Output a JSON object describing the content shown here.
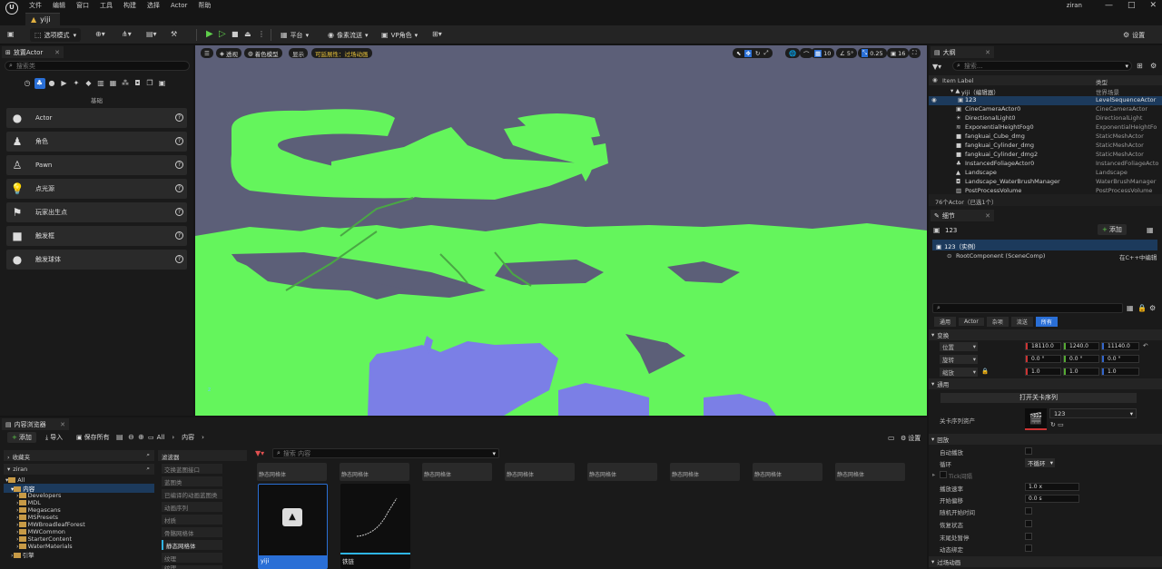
{
  "menubar": {
    "logo": "U",
    "menus": [
      "文件",
      "编辑",
      "窗口",
      "工具",
      "构建",
      "选择",
      "Actor",
      "帮助"
    ],
    "doc_tab": "yiji",
    "user": "ziran",
    "window_buttons": [
      "—",
      "□",
      "✕"
    ]
  },
  "toolbar": {
    "select_mode": "选项模式",
    "platform": "平台",
    "pixel_streaming": "像素流送",
    "vp_role": "VP角色",
    "settings": "设置"
  },
  "place_actor": {
    "tab": "放置Actor",
    "search_placeholder": "搜索类",
    "category": "基础",
    "items": [
      {
        "label": "Actor",
        "icon": "sphere-icon"
      },
      {
        "label": "角色",
        "icon": "character-icon"
      },
      {
        "label": "Pawn",
        "icon": "pawn-icon"
      },
      {
        "label": "点光源",
        "icon": "bulb-icon"
      },
      {
        "label": "玩家出生点",
        "icon": "flag-icon"
      },
      {
        "label": "触发框",
        "icon": "cube-icon"
      },
      {
        "label": "触发球体",
        "icon": "sphere-icon"
      }
    ]
  },
  "viewport": {
    "perspective": "透视",
    "view_mode": "着色模型",
    "show": "显示",
    "visibility": "可延展性：过场动画",
    "grid": "10",
    "angle": "5°",
    "scale": "0.25",
    "speed": "16",
    "axis": "z"
  },
  "outliner": {
    "tab": "大纲",
    "search_placeholder": "搜索...",
    "col_label": "Item Label",
    "col_type": "类型",
    "root": {
      "label": "yiji（编辑器）",
      "type": "世界场景"
    },
    "rows": [
      {
        "label": "123",
        "type": "LevelSequenceActor",
        "selected": true
      },
      {
        "label": "CineCameraActor0",
        "type": "CineCameraActor"
      },
      {
        "label": "DirectionalLight0",
        "type": "DirectionalLight"
      },
      {
        "label": "ExponentialHeightFog0",
        "type": "ExponentialHeightFo"
      },
      {
        "label": "fangkuai_Cube_dmg",
        "type": "StaticMeshActor"
      },
      {
        "label": "fangkuai_Cylinder_dmg",
        "type": "StaticMeshActor"
      },
      {
        "label": "fangkuai_Cylinder_dmg2",
        "type": "StaticMeshActor"
      },
      {
        "label": "InstancedFoliageActor0",
        "type": "InstancedFoliageActo"
      },
      {
        "label": "Landscape",
        "type": "Landscape"
      },
      {
        "label": "Landscape_WaterBrushManager",
        "type": "WaterBrushManager"
      },
      {
        "label": "PostProcessVolume",
        "type": "PostProcessVolume"
      }
    ],
    "status": "76个Actor（已选1个）"
  },
  "details": {
    "tab": "细节",
    "object_name": "123",
    "add_button": "添加",
    "instance": "123（实例）",
    "root_component": "RootComponent (SceneComp)",
    "root_note": "在C++中编辑",
    "filter_tabs": [
      "通用",
      "Actor",
      "杂项",
      "流送",
      "所有"
    ],
    "transform": {
      "header": "变换",
      "location_label": "位置",
      "location": [
        "18110.0",
        "1240.0",
        "11140.0"
      ],
      "rotation_label": "旋转",
      "rotation": [
        "0.0 °",
        "0.0 °",
        "0.0 °"
      ],
      "scale_label": "缩放",
      "scale": [
        "1.0",
        "1.0",
        "1.0"
      ]
    },
    "general": {
      "header": "通用",
      "open_button": "打开关卡序列",
      "asset_label": "关卡序列资产",
      "asset_value": "123"
    },
    "playback": {
      "header": "回放",
      "auto_play": "自动播放",
      "loop": "循环",
      "loop_value": "不循环",
      "tick_interval": "Tick间隔",
      "play_rate": "播放速率",
      "play_rate_value": "1.0 x",
      "start_offset": "开始偏移",
      "start_offset_value": "0.0 s",
      "random_start": "随机开始时间",
      "restore_state": "恢复状态",
      "pause_at_end": "末尾处暂停",
      "dynamic_binding": "动态绑定"
    },
    "transitions": "过场动画"
  },
  "content_browser": {
    "tab": "内容浏览器",
    "add": "添加",
    "import": "导入",
    "save_all": "保存所有",
    "path": [
      "All",
      "内容"
    ],
    "settings": "设置",
    "favorites": "收藏夹",
    "project": "ziran",
    "search_placeholder": "搜索 内容",
    "tree": {
      "all": "All",
      "content": "内容",
      "folders": [
        "Developers",
        "MDL",
        "Megascans",
        "MSPresets",
        "MWBroadleafForest",
        "MWCommon",
        "StarterContent",
        "WaterMaterials"
      ],
      "engine": "引擎"
    },
    "filters_header": "滤波器",
    "filters": [
      "交换蓝图接口",
      "蓝图类",
      "已编译的动画蓝图类",
      "动画序列",
      "材质",
      "骨骼网格体",
      "静态网格体",
      "纹理",
      "纹理"
    ],
    "tile_type": "静态网格体",
    "assets": [
      {
        "name": "yiji"
      },
      {
        "name": "铁链"
      }
    ]
  }
}
